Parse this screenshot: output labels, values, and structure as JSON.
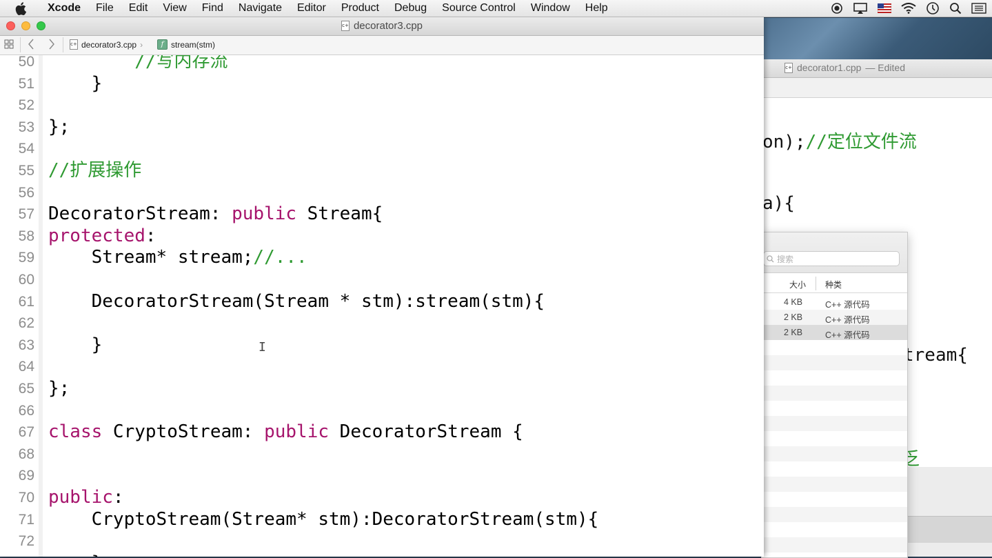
{
  "menubar": {
    "app": "Xcode",
    "items": [
      "File",
      "Edit",
      "View",
      "Find",
      "Navigate",
      "Editor",
      "Product",
      "Debug",
      "Source Control",
      "Window",
      "Help"
    ],
    "status_icons": [
      "record-icon",
      "airplay-icon",
      "input-source-flag-icon",
      "wifi-icon",
      "time-machine-icon",
      "spotlight-search-icon",
      "notification-list-icon"
    ]
  },
  "main_window": {
    "title": "decorator3.cpp",
    "jumpbar": {
      "file": "decorator3.cpp",
      "symbol": "stream(stm)"
    },
    "lines": [
      {
        "n": "50",
        "code": [
          {
            "t": "        ",
            "c": ""
          },
          {
            "t": "//写内存流",
            "c": "cm"
          }
        ]
      },
      {
        "n": "51",
        "code": [
          {
            "t": "    }",
            "c": ""
          }
        ]
      },
      {
        "n": "52",
        "code": []
      },
      {
        "n": "53",
        "code": [
          {
            "t": "};",
            "c": ""
          }
        ]
      },
      {
        "n": "54",
        "code": []
      },
      {
        "n": "55",
        "code": [
          {
            "t": "//扩展操作",
            "c": "cm"
          }
        ]
      },
      {
        "n": "56",
        "code": []
      },
      {
        "n": "57",
        "code": [
          {
            "t": "DecoratorStream: ",
            "c": ""
          },
          {
            "t": "public",
            "c": "kw"
          },
          {
            "t": " Stream{",
            "c": ""
          }
        ]
      },
      {
        "n": "58",
        "code": [
          {
            "t": "protected",
            "c": "kw"
          },
          {
            "t": ":",
            "c": ""
          }
        ]
      },
      {
        "n": "59",
        "code": [
          {
            "t": "    Stream* stream;",
            "c": ""
          },
          {
            "t": "//...",
            "c": "cm"
          }
        ]
      },
      {
        "n": "60",
        "code": []
      },
      {
        "n": "61",
        "code": [
          {
            "t": "    DecoratorStream(Stream * stm):stream(stm){",
            "c": ""
          }
        ]
      },
      {
        "n": "62",
        "code": []
      },
      {
        "n": "63",
        "code": [
          {
            "t": "    }",
            "c": ""
          }
        ]
      },
      {
        "n": "64",
        "code": []
      },
      {
        "n": "65",
        "code": [
          {
            "t": "};",
            "c": ""
          }
        ]
      },
      {
        "n": "66",
        "code": []
      },
      {
        "n": "67",
        "code": [
          {
            "t": "class",
            "c": "kw"
          },
          {
            "t": " CryptoStream: ",
            "c": ""
          },
          {
            "t": "public",
            "c": "kw"
          },
          {
            "t": " DecoratorStream {",
            "c": ""
          }
        ]
      },
      {
        "n": "68",
        "code": []
      },
      {
        "n": "69",
        "code": []
      },
      {
        "n": "70",
        "code": [
          {
            "t": "public",
            "c": "kw"
          },
          {
            "t": ":",
            "c": ""
          }
        ]
      },
      {
        "n": "71",
        "code": [
          {
            "t": "    CryptoStream(Stream* stm):DecoratorStream(stm){",
            "c": ""
          }
        ]
      },
      {
        "n": "72",
        "code": []
      },
      {
        "n": "73",
        "code": [
          {
            "t": "    }",
            "c": ""
          }
        ]
      }
    ]
  },
  "background_window": {
    "title": "decorator1.cpp",
    "status": "— Edited",
    "lines": [
      {
        "code": "on);",
        "comment": "//定位文件流"
      },
      {
        "code": "a){",
        "comment": ""
      },
      {
        "code": "tream{",
        "comment": ""
      },
      {
        "code": "",
        "comment": "乏"
      }
    ]
  },
  "finder": {
    "search_placeholder": "搜索",
    "headers": {
      "size": "大小",
      "kind": "种类"
    },
    "rows": [
      {
        "size": "4 KB",
        "kind": "C++ 源代码"
      },
      {
        "size": "2 KB",
        "kind": "C++ 源代码"
      },
      {
        "size": "2 KB",
        "kind": "C++ 源代码"
      }
    ]
  }
}
